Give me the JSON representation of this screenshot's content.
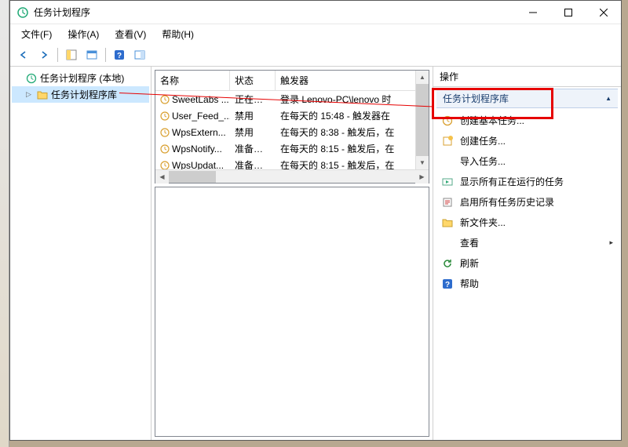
{
  "window": {
    "title": "任务计划程序"
  },
  "menus": {
    "file": "文件(F)",
    "action": "操作(A)",
    "view": "查看(V)",
    "help": "帮助(H)"
  },
  "tree": {
    "root": "任务计划程序 (本地)",
    "library": "任务计划程序库"
  },
  "columns": {
    "name": "名称",
    "state": "状态",
    "trigger": "触发器"
  },
  "tasks": [
    {
      "name": "SweetLabs ...",
      "state": "正在运行",
      "trigger": "登录 Lenovo-PC\\lenovo 时"
    },
    {
      "name": "User_Feed_...",
      "state": "禁用",
      "trigger": "在每天的 15:48 - 触发器在"
    },
    {
      "name": "WpsExtern...",
      "state": "禁用",
      "trigger": "在每天的 8:38 - 触发后，在"
    },
    {
      "name": "WpsNotify...",
      "state": "准备就绪",
      "trigger": "在每天的 8:15 - 触发后，在"
    },
    {
      "name": "WpsUpdat...",
      "state": "准备就绪",
      "trigger": "在每天的 8:15 - 触发后，在"
    }
  ],
  "actions": {
    "header": "操作",
    "section": "任务计划程序库",
    "items": {
      "create_basic": "创建基本任务...",
      "create_task": "创建任务...",
      "import_task": "导入任务...",
      "show_running": "显示所有正在运行的任务",
      "enable_history": "启用所有任务历史记录",
      "new_folder": "新文件夹...",
      "view": "查看",
      "refresh": "刷新",
      "help": "帮助"
    }
  }
}
